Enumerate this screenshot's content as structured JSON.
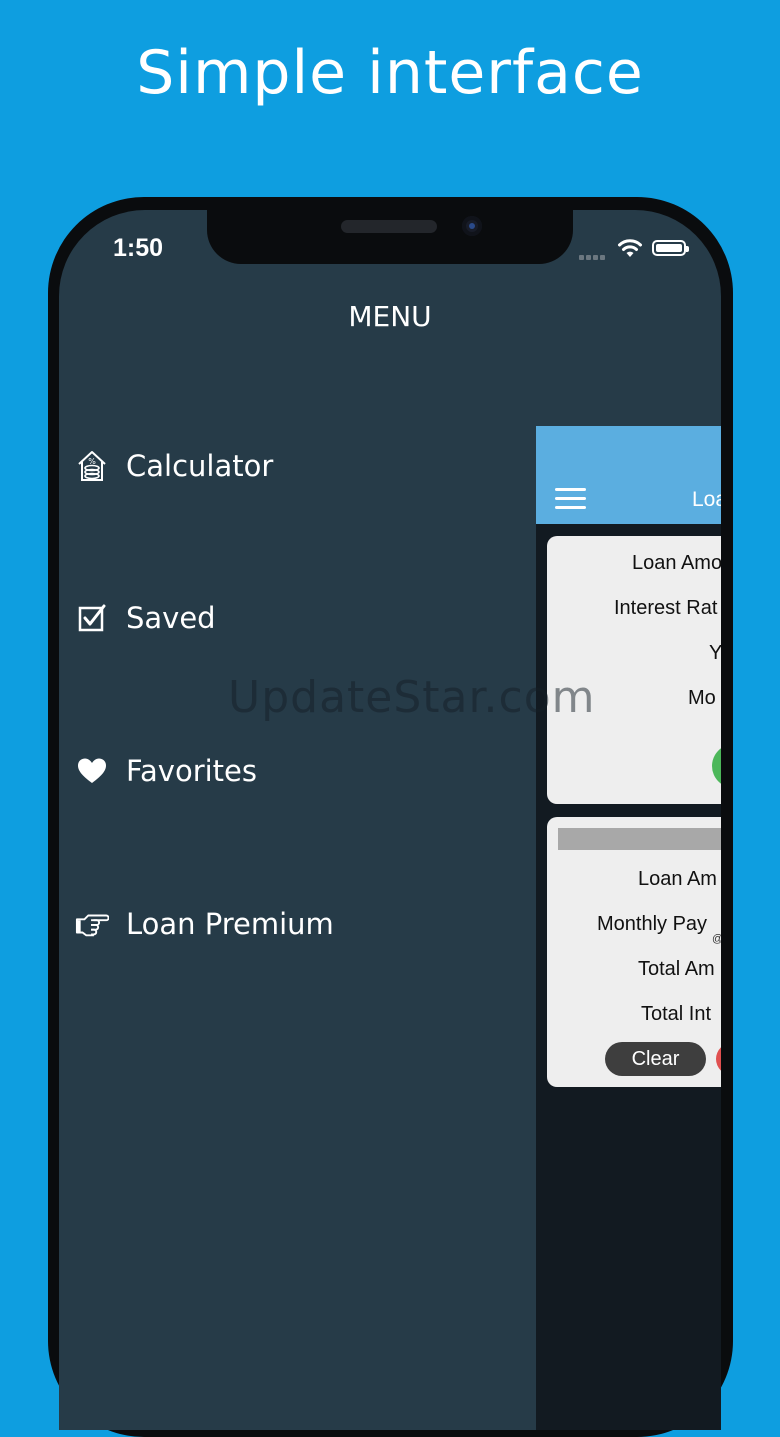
{
  "headline": "Simple interface",
  "status_bar": {
    "time": "1:50",
    "icons": [
      "signal-icon",
      "wifi-icon",
      "battery-icon"
    ]
  },
  "menu": {
    "title": "MENU",
    "items": [
      {
        "label": "Calculator",
        "icon": "house-percent-icon"
      },
      {
        "label": "Saved",
        "icon": "checkbox-icon"
      },
      {
        "label": "Favorites",
        "icon": "heart-icon"
      },
      {
        "label": "Loan Premium",
        "icon": "pointing-hand-icon"
      }
    ]
  },
  "app_preview": {
    "title": "Loa",
    "input_card": {
      "fields": [
        "Loan Amo",
        "Interest Rat",
        "Y",
        "Mo"
      ]
    },
    "result_card": {
      "fields": [
        "Loan Am",
        "Monthly Pay",
        "Total Am",
        "Total Int"
      ],
      "at_symbol": "@",
      "clear_label": "Clear"
    }
  },
  "watermark": "UpdateStar.com",
  "colors": {
    "background": "#0e9ee0",
    "menu_background": "#263b48",
    "app_header": "#5baee0",
    "card": "#eeeeee"
  }
}
